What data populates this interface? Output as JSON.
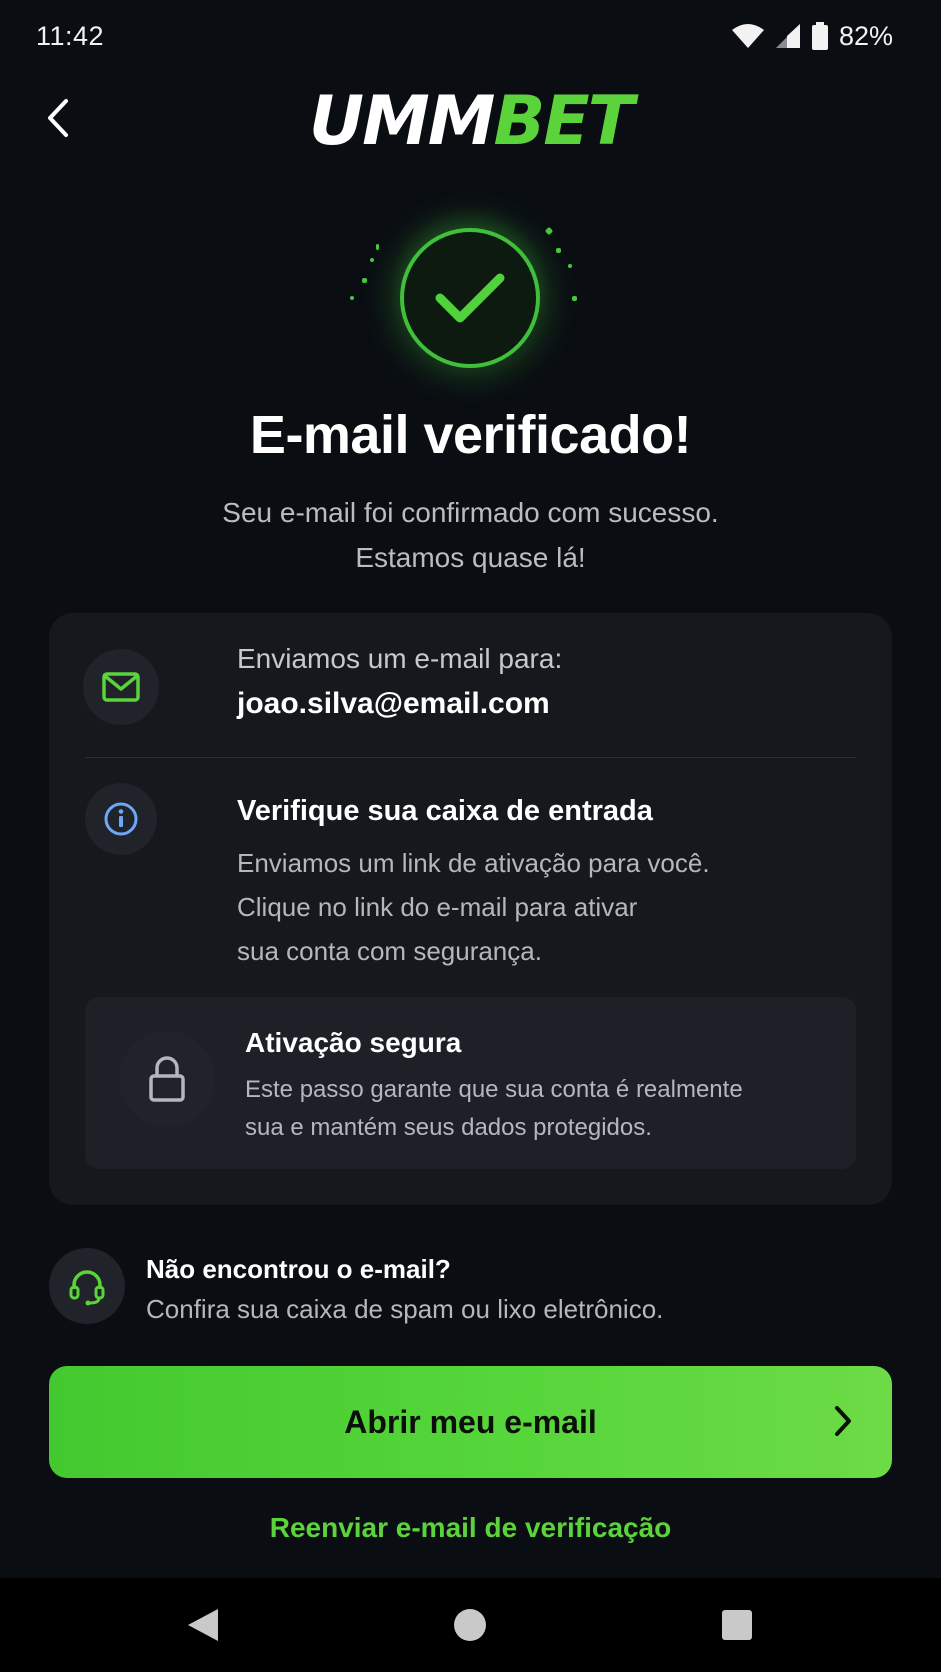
{
  "status_bar": {
    "time": "11:42",
    "battery": "82%",
    "icons": [
      "wifi-icon",
      "signal-icon",
      "battery-icon"
    ]
  },
  "header": {
    "logo_part1": "UMM",
    "logo_part2": "BET",
    "back_icon": "chevron-left-icon"
  },
  "hero": {
    "icon": "check-circle-icon",
    "title": "E-mail verificado!",
    "subtitle_line1": "Seu e-mail foi confirmado com sucesso.",
    "subtitle_line2": "Estamos quase lá!"
  },
  "card": {
    "sent_label": "Enviamos um e-mail para:",
    "sent_email": "joao.silva@email.com",
    "verify_title": "Verifique sua caixa de entrada",
    "verify_lines": [
      "Enviamos um link de ativação para você.",
      "Clique no link do e-mail para ativar",
      "sua conta com segurança."
    ],
    "secure_title": "Ativação segura",
    "secure_lines": [
      "Este passo garante que sua conta é realmente",
      "sua e mantém seus dados protegidos."
    ]
  },
  "help": {
    "title": "Não encontrou o e-mail?",
    "text": "Confira sua caixa de spam ou lixo eletrônico."
  },
  "actions": {
    "primary_label": "Abrir meu e-mail",
    "resend_label": "Reenviar e-mail de verificação"
  },
  "colors": {
    "background": "#0a0d12",
    "accent": "#5bd43b",
    "card": "#15181d"
  }
}
